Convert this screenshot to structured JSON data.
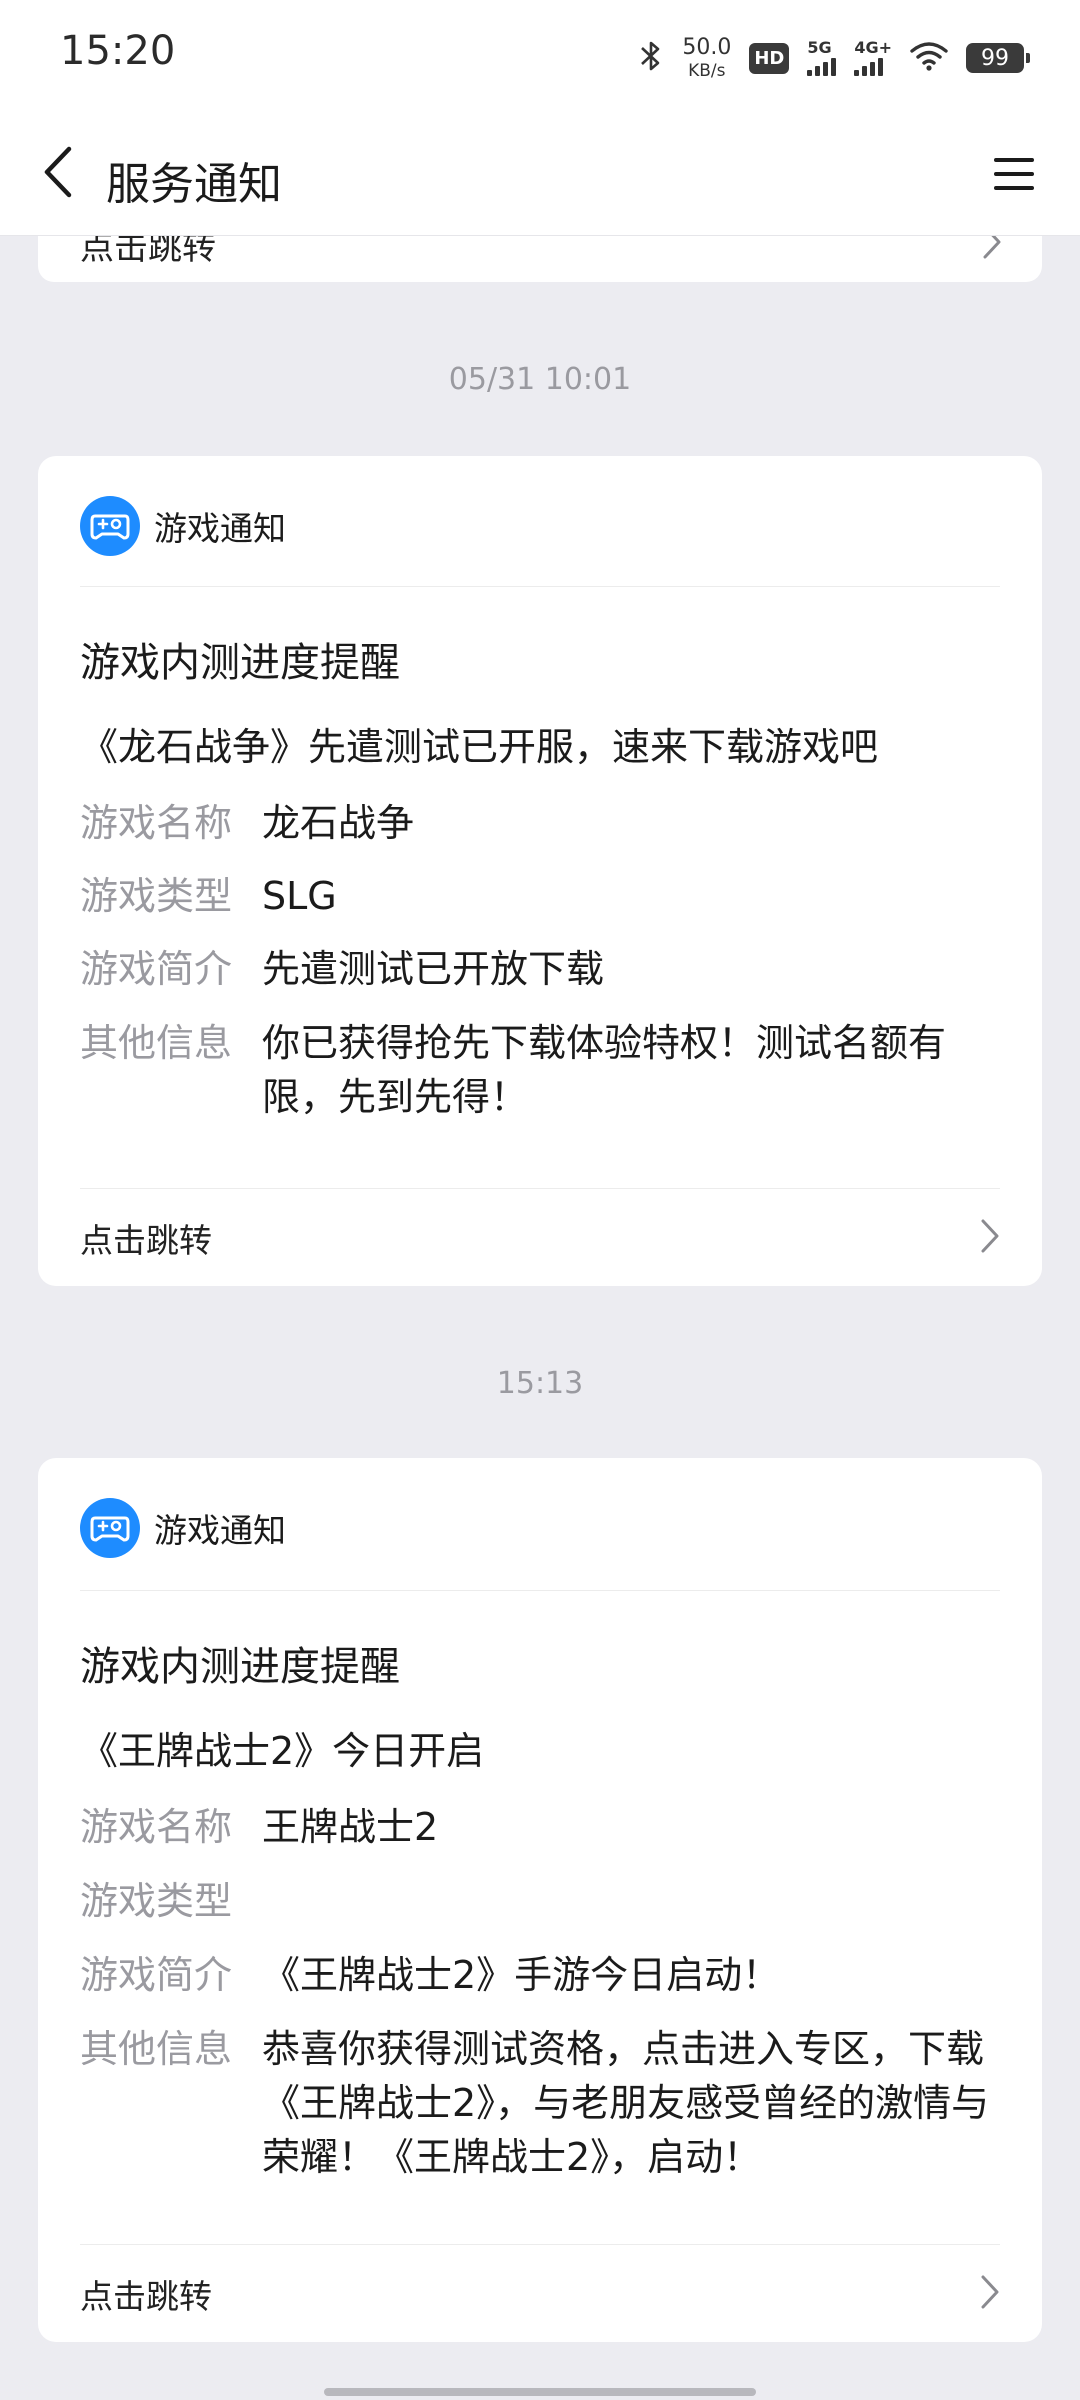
{
  "status_bar": {
    "time": "15:20",
    "speed_value": "50.0",
    "speed_unit": "KB/s",
    "hd_label": "HD",
    "net1": "5G",
    "net2": "4G+",
    "battery": "99"
  },
  "header": {
    "title": "服务通知",
    "icons": [
      "back-arrow-icon",
      "menu-icon"
    ]
  },
  "partial_card": {
    "jump_label": "点击跳转"
  },
  "messages": [
    {
      "timestamp": "05/31 10:01",
      "app_name": "游戏通知",
      "title": "游戏内测进度提醒",
      "subtitle": "《龙石战争》先遣测试已开服，速来下载游戏吧",
      "fields": [
        {
          "key": "游戏名称",
          "value": "龙石战争"
        },
        {
          "key": "游戏类型",
          "value": "SLG"
        },
        {
          "key": "游戏简介",
          "value": "先遣测试已开放下载"
        },
        {
          "key": "其他信息",
          "value": "你已获得抢先下载体验特权！测试名额有限，先到先得！"
        }
      ],
      "jump_label": "点击跳转"
    },
    {
      "timestamp": "15:13",
      "app_name": "游戏通知",
      "title": "游戏内测进度提醒",
      "subtitle": "《王牌战士2》今日开启",
      "fields": [
        {
          "key": "游戏名称",
          "value": "王牌战士2"
        },
        {
          "key": "游戏类型",
          "value": ""
        },
        {
          "key": "游戏简介",
          "value": "《王牌战士2》手游今日启动！"
        },
        {
          "key": "其他信息",
          "value": "恭喜你获得测试资格，点击进入专区，下载《王牌战士2》，与老朋友感受曾经的激情与荣耀！《王牌战士2》，启动！"
        }
      ],
      "jump_label": "点击跳转"
    }
  ],
  "colors": {
    "background": "#ececf1",
    "card": "#ffffff",
    "accent": "#1e8cff",
    "muted": "#9a9aa0"
  }
}
